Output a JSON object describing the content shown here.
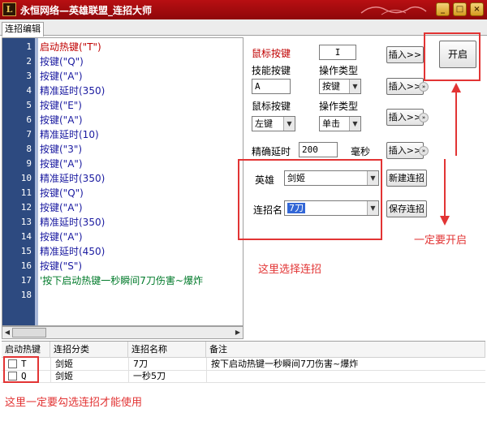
{
  "window": {
    "title": "永恒网络—英雄联盟_连招大师",
    "logo_letter": "L",
    "minimize_glyph": "_",
    "restore_glyph": "□",
    "close_glyph": "×"
  },
  "tabs": [
    "连招编辑"
  ],
  "editor": {
    "line_numbers": [
      "1",
      "2",
      "3",
      "4",
      "5",
      "6",
      "7",
      "8",
      "9",
      "10",
      "11",
      "12",
      "13",
      "14",
      "15",
      "16",
      "17",
      "18"
    ],
    "lines": [
      {
        "text": "启动热键(\"T\")",
        "color": "#c00000"
      },
      {
        "text": "按键(\"Q\")",
        "color": "#1a1aa0"
      },
      {
        "text": "按键(\"A\")",
        "color": "#1a1aa0"
      },
      {
        "text": "精准延时(350)",
        "color": "#1a1aa0"
      },
      {
        "text": "按键(\"E\")",
        "color": "#1a1aa0"
      },
      {
        "text": "按键(\"A\")",
        "color": "#1a1aa0"
      },
      {
        "text": "精准延时(10)",
        "color": "#1a1aa0"
      },
      {
        "text": "按键(\"3\")",
        "color": "#1a1aa0"
      },
      {
        "text": "按键(\"A\")",
        "color": "#1a1aa0"
      },
      {
        "text": "精准延时(350)",
        "color": "#1a1aa0"
      },
      {
        "text": "按键(\"Q\")",
        "color": "#1a1aa0"
      },
      {
        "text": "按键(\"A\")",
        "color": "#1a1aa0"
      },
      {
        "text": "精准延时(350)",
        "color": "#1a1aa0"
      },
      {
        "text": "按键(\"A\")",
        "color": "#1a1aa0"
      },
      {
        "text": "精准延时(450)",
        "color": "#1a1aa0"
      },
      {
        "text": "按键(\"S\")",
        "color": "#1a1aa0"
      },
      {
        "text": "'按下启动热键一秒瞬间7刀伤害~爆炸",
        "color": "#007a2a"
      },
      {
        "text": "",
        "color": "#000"
      }
    ]
  },
  "panel": {
    "mouse_hotkey_label": "鼠标按键",
    "mouse_hotkey_value": "I",
    "skill_key_label": "技能按键",
    "op_type_label": "操作类型",
    "skill_key_value": "A",
    "op_type_value": "按键",
    "mouse_key_label": "鼠标按键",
    "op_type2_label": "操作类型",
    "mouse_key_value": "左键",
    "op_type2_value": "单击",
    "delay_label": "精确延时",
    "delay_value": "200",
    "delay_unit": "毫秒",
    "insert_label": "插入>>",
    "start_label": "开启",
    "hero_label": "英雄",
    "hero_value": "剑姬",
    "combo_name_label": "连招名",
    "combo_name_value": "7刀",
    "new_combo_label": "新建连招",
    "save_combo_label": "保存连招"
  },
  "annotations": {
    "must_start": "一定要开启",
    "select_here": "这里选择连招",
    "must_check": "这里一定要勾选连招才能使用"
  },
  "table": {
    "headers": [
      "启动热键",
      "连招分类",
      "连招名称",
      "备注"
    ],
    "rows": [
      {
        "hotkey": "T",
        "category": "剑姬",
        "name": "7刀",
        "note": "按下启动热键一秒瞬间7刀伤害~爆炸"
      },
      {
        "hotkey": "Q",
        "category": "剑姬",
        "name": "一秒5刀",
        "note": ""
      }
    ]
  },
  "colors": {
    "titlebar": "#a00b0e",
    "gutter": "#2d4a80",
    "annotation_red": "#e23434"
  }
}
